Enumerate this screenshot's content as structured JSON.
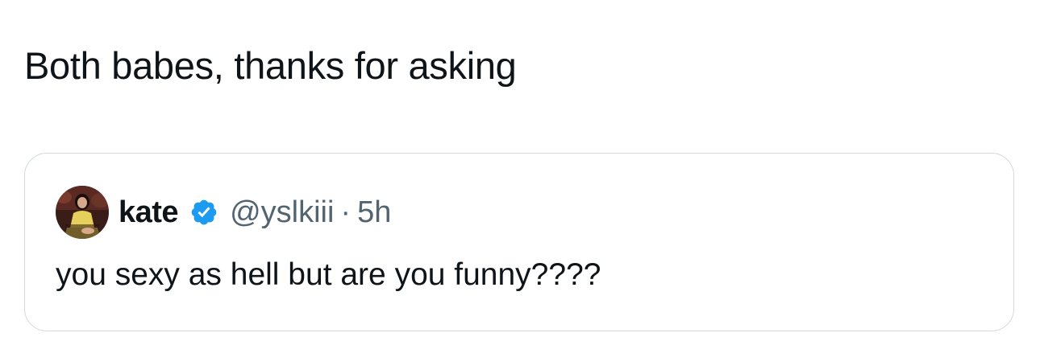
{
  "tweet": {
    "text": "Both babes, thanks for asking"
  },
  "quoted_tweet": {
    "display_name": "kate",
    "handle": "@yslkiii",
    "separator": "·",
    "timestamp": "5h",
    "text": "you sexy as hell but are you funny????",
    "avatar_icon": "user-avatar",
    "verified_icon": "verified-badge-icon"
  },
  "colors": {
    "text_primary": "#0f1419",
    "text_secondary": "#536471",
    "verified_blue": "#1d9bf0",
    "card_border": "#d3d9de"
  }
}
